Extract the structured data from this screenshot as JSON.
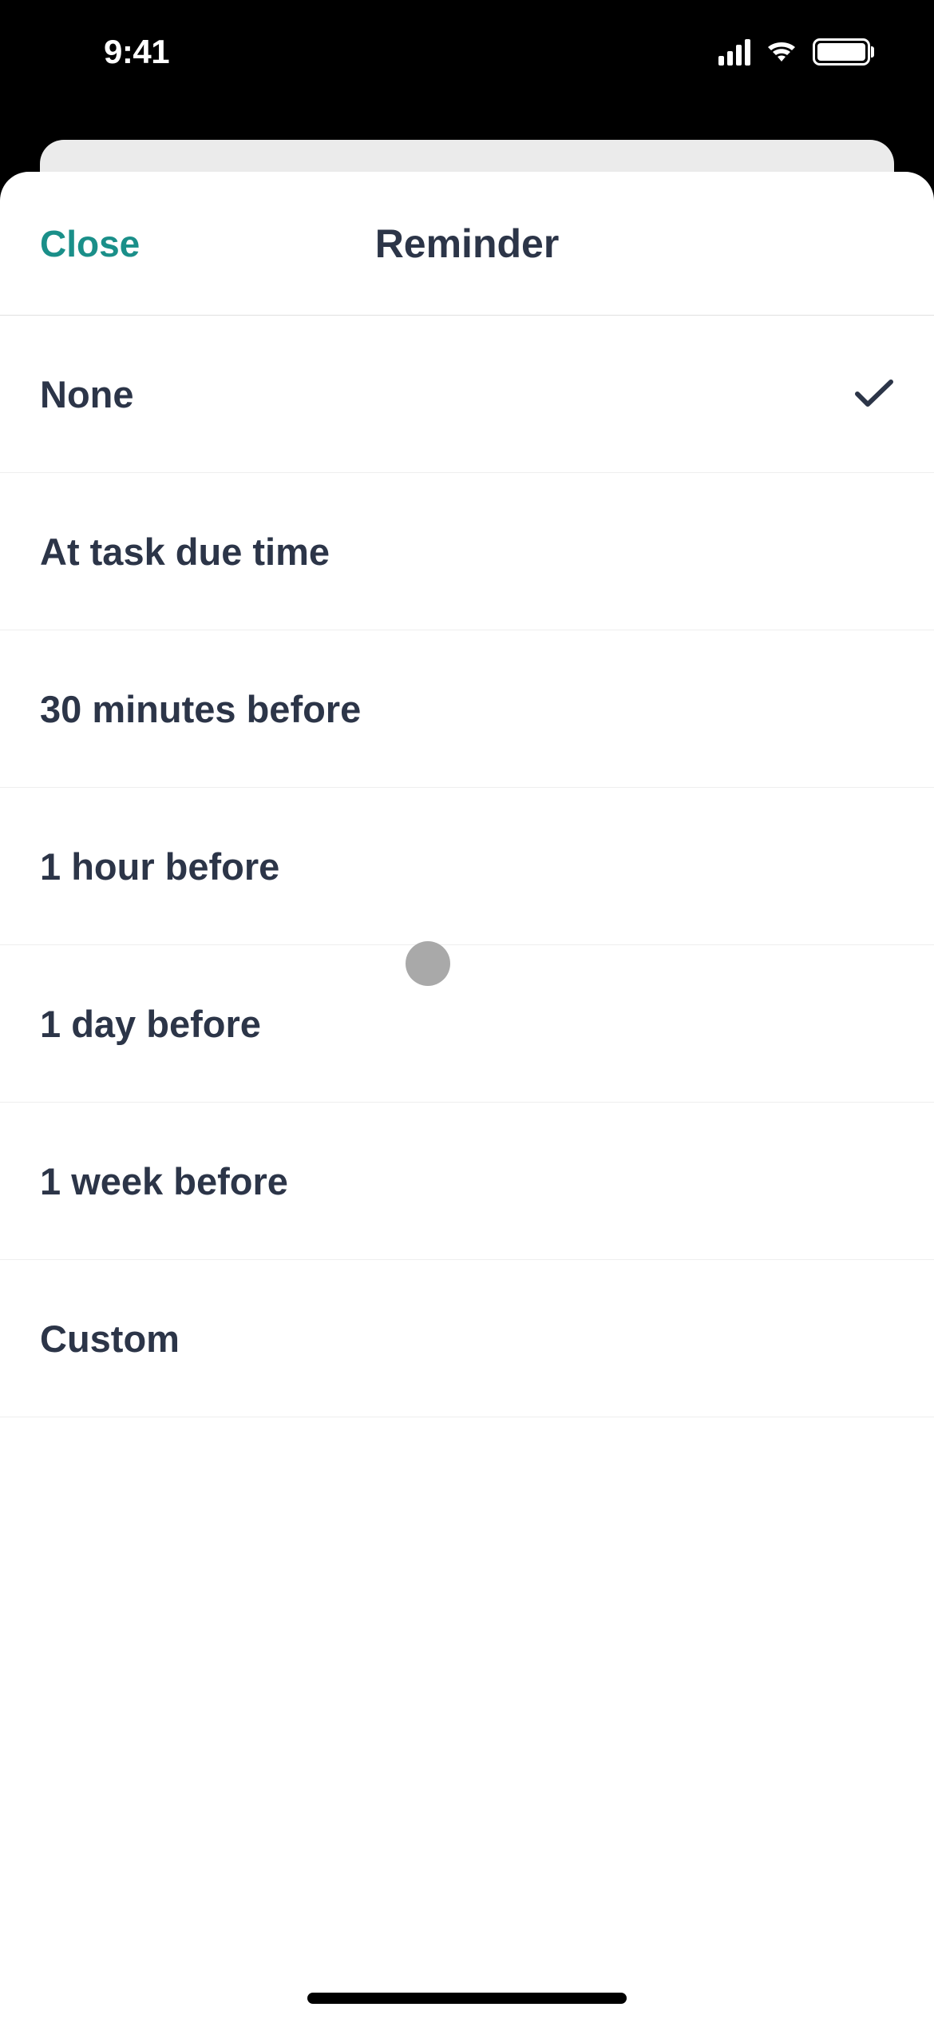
{
  "status_bar": {
    "time": "9:41"
  },
  "header": {
    "close_label": "Close",
    "title": "Reminder"
  },
  "options": [
    {
      "label": "None",
      "selected": true
    },
    {
      "label": "At task due time",
      "selected": false
    },
    {
      "label": "30 minutes before",
      "selected": false
    },
    {
      "label": "1 hour before",
      "selected": false
    },
    {
      "label": "1 day before",
      "selected": false
    },
    {
      "label": "1 week before",
      "selected": false
    },
    {
      "label": "Custom",
      "selected": false
    }
  ]
}
